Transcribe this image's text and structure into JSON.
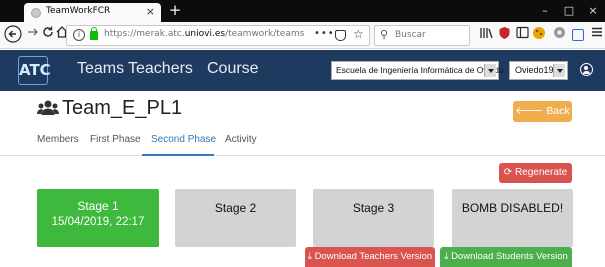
{
  "browser": {
    "tab_title": "TeamWorkFCR",
    "tab_close": "×",
    "new_tab": "+",
    "window_controls": [
      "–",
      "□",
      "×"
    ],
    "url_host": "merak.atc.",
    "url_domain": "uniovi.es",
    "url_prefix": "https://",
    "url_path": "/teamwork/teams",
    "url_more": "•••",
    "search_placeholder": "Buscar"
  },
  "app": {
    "logo": "ATC",
    "nav": [
      "Teams",
      "Teachers",
      "Course"
    ],
    "school_select": "Escuela de Ingeniería Informática de Oviedo",
    "course_select": "Oviedo19"
  },
  "team": {
    "title": "Team_E_PL1",
    "back_label": "Back",
    "tabs": [
      "Members",
      "First Phase",
      "Second Phase",
      "Activity"
    ],
    "active_tab": "Second Phase"
  },
  "actions": {
    "regenerate": "Regenerate",
    "download_teachers": "Download Teachers Version",
    "download_students": "Download Students Version"
  },
  "stages": [
    {
      "title": "Stage 1",
      "date": "15/04/2019, 22:17",
      "status_color": "#3eb93e"
    },
    {
      "title": "Stage 2"
    },
    {
      "title": "Stage 3"
    },
    {
      "title": "BOMB DISABLED!"
    }
  ],
  "colors": {
    "navbar": "#1f3a5f",
    "warning": "#f0ad4e",
    "danger": "#d9534f",
    "success": "#4cae4c",
    "link": "#337ab7"
  }
}
